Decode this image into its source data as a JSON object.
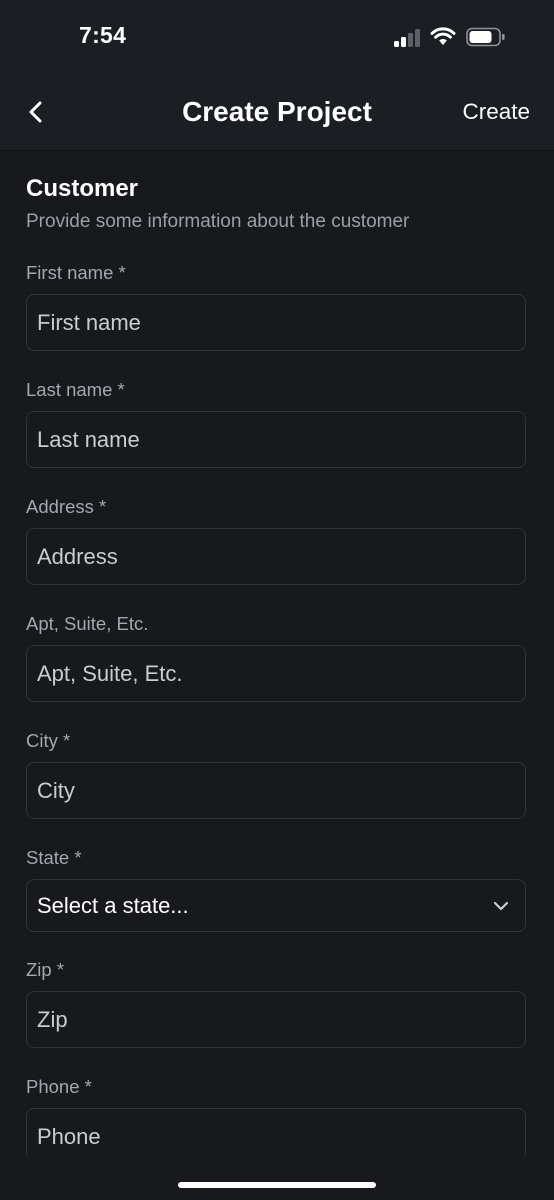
{
  "status_bar": {
    "time": "7:54",
    "signal_icon": "cellular-signal-icon",
    "wifi_icon": "wifi-icon",
    "battery_icon": "battery-icon"
  },
  "nav": {
    "back_icon": "chevron-left-icon",
    "title": "Create Project",
    "create_label": "Create"
  },
  "section": {
    "title": "Customer",
    "subtitle": "Provide some information about the customer"
  },
  "fields": {
    "first_name": {
      "label": "First name *",
      "placeholder": "First name"
    },
    "last_name": {
      "label": "Last name *",
      "placeholder": "Last name"
    },
    "address": {
      "label": "Address *",
      "placeholder": "Address"
    },
    "apt": {
      "label": "Apt, Suite, Etc.",
      "placeholder": "Apt, Suite, Etc."
    },
    "city": {
      "label": "City *",
      "placeholder": "City"
    },
    "state": {
      "label": "State *",
      "selected": "Select a state..."
    },
    "zip": {
      "label": "Zip *",
      "placeholder": "Zip"
    },
    "phone": {
      "label": "Phone *",
      "placeholder": "Phone"
    }
  },
  "colors": {
    "background": "#17191c",
    "header_background": "#1b1e22",
    "field_border": "#30343a",
    "label_text": "#a3a8b0",
    "primary_text": "#ffffff"
  }
}
